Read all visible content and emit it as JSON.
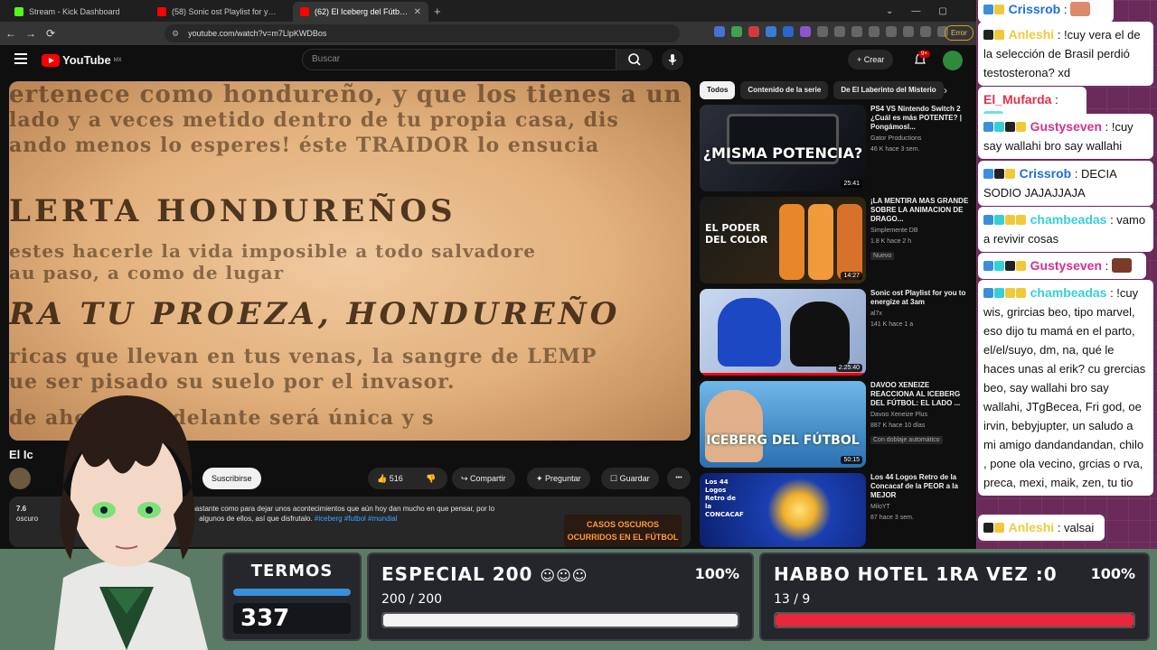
{
  "browser": {
    "tabs": [
      {
        "title": "Stream - Kick Dashboard",
        "color": "#53fc18",
        "active": false
      },
      {
        "title": "(58) Sonic ost Playlist for you to energize",
        "color": "#ff0000",
        "active": false
      },
      {
        "title": "(62) El Iceberg del Fútbol - YouTube",
        "color": "#ff0000",
        "active": true
      }
    ],
    "url": "youtube.com/watch?v=m7LlpKWDBos",
    "error_label": "Error"
  },
  "youtube": {
    "logo": "YouTube",
    "region": "MX",
    "search_placeholder": "Buscar",
    "create_label": "Crear",
    "notif_count": "9+",
    "video": {
      "frame_lines": [
        "ertenece como hondureño, y que los tienes a un la",
        "lado y a veces metido dentro de tu propia casa, dis",
        "ando menos lo esperes! éste TRAIDOR lo ensucia",
        "LERTA HONDUREÑOS",
        "estes hacerle la vida imposible a todo salvadore",
        "au paso, a como de lugar",
        "RA TU PROEZA, HONDUREÑO",
        "ricas que llevan en tus venas, la sangre de LEMP",
        "ue ser pisado su suelo por el invasor.",
        "de ahora en adelante será única y s"
      ],
      "title": "El Ic",
      "subscribe_label": "Suscribirse",
      "likes": "516",
      "share_label": "Compartir",
      "ask_label": "Preguntar",
      "save_label": "Guardar",
      "more_label": "•••",
      "description": {
        "views": "7.6",
        "text_line1": "bastante como para dejar unos acontecimientos que aún hoy dan mucho en que pensar, por lo",
        "text_line2": "oscuro",
        "text_line2b": "algunos de ellos, así que disfrutalo.",
        "tags": "#iceberg #futbol #mundial",
        "thumb_text": "CASOS OSCUROS OCURRIDOS EN EL FÚTBOL"
      }
    },
    "chips": [
      {
        "label": "Todos",
        "active": true
      },
      {
        "label": "Contenido de la serie",
        "active": false
      },
      {
        "label": "De El Laberinto del Misterio",
        "active": false
      }
    ],
    "recommendations": [
      {
        "title": "PS4 VS Nintendo Switch 2 ¿Cuál es más POTENTE? | Pongámosl...",
        "channel": "Gator Productions",
        "stats": "46 K  hace 3 sem.",
        "duration": "25:41",
        "thumb_text": "¿MISMA POTENCIA?",
        "badge": ""
      },
      {
        "title": "¡LA MENTIRA MAS GRANDE SOBRE LA ANIMACION DE DRAGO...",
        "channel": "Simplemente DB",
        "stats": "1.8 K  hace 2 h",
        "duration": "14:27",
        "thumb_text": "EL PODER DEL COLOR",
        "badge": "Nuevo"
      },
      {
        "title": "Sonic ost Playlist for you to energize at 3am",
        "channel": "al7x",
        "stats": "141 K  hace 1 a",
        "duration": "2:25:40",
        "thumb_text": "",
        "badge": ""
      },
      {
        "title": "DAVOO XENEIZE REACCIONA AL ICEBERG DEL FÚTBOL: EL LADO ...",
        "channel": "Davoo Xeneize Plus",
        "stats": "887 K  hace 10 días",
        "duration": "50:15",
        "thumb_text": "ICEBERG DEL FÚTBOL",
        "badge": "Con doblaje automático"
      },
      {
        "title": "Los 44 Logos Retro de la Concacaf de la PEOR a la MEJOR",
        "channel": "MiloYT",
        "stats": "87  hace 3 sem.",
        "duration": "",
        "thumb_text": "Los 44 Logos Retro de la CONCACAF",
        "badge": ""
      }
    ]
  },
  "chat": {
    "messages": [
      {
        "user": "Crissrob",
        "color": "#1e6fd9",
        "text": "",
        "emote": "#d98b6b"
      },
      {
        "user": "Anleshi",
        "color": "#f0c93a",
        "text": "!cuy vera el de la selección de Brasil perdió testosterona? xd",
        "emote": ""
      },
      {
        "user": "El_Mufarda",
        "color": "#e0304a",
        "text": "",
        "emote": "#6ee0e8"
      },
      {
        "user": "Gustyseven",
        "color": "#d4318a",
        "text": "!cuy say wallahi bro say wallahi",
        "emote": ""
      },
      {
        "user": "Crissrob",
        "color": "#1e6fd9",
        "text": "DECIA SODIO JAJAJJAJA",
        "emote": ""
      },
      {
        "user": "chambeadas",
        "color": "#35d0d6",
        "text": "vamo a revivir cosas",
        "emote": ""
      },
      {
        "user": "Gustyseven",
        "color": "#d4318a",
        "text": "",
        "emote": "#7a3a2a"
      },
      {
        "user": "chambeadas",
        "color": "#35d0d6",
        "text": "!cuy wis, grircias beo, tipo marvel, eso dijo tu mamá en el parto, el/el/suyo, dm, na, qué le haces unas al erik? cu grercias beo, say wallahi bro say wallahi, JTgBecea, Fri god, oe irvin, bebyjupter, un saludo a mi amigo dandandandan, chilo , pone ola vecino, grcias o rva, preca, mexi, maik, zen, tu tio",
        "emote": ""
      },
      {
        "user": "Anleshi",
        "color": "#f0c93a",
        "text": "valsai",
        "emote": ""
      }
    ]
  },
  "goals": {
    "termos": {
      "title": "TERMOS",
      "value": "337"
    },
    "especial": {
      "title": "ESPECIAL 200",
      "percent": "100%",
      "count": "200 / 200",
      "progress": 1.0,
      "color": "#f3f3f3"
    },
    "habbo": {
      "title": "HABBO HOTEL 1RA VEZ :0",
      "percent": "100%",
      "count": "13 / 9",
      "progress": 1.0,
      "color": "#e8283a"
    }
  }
}
